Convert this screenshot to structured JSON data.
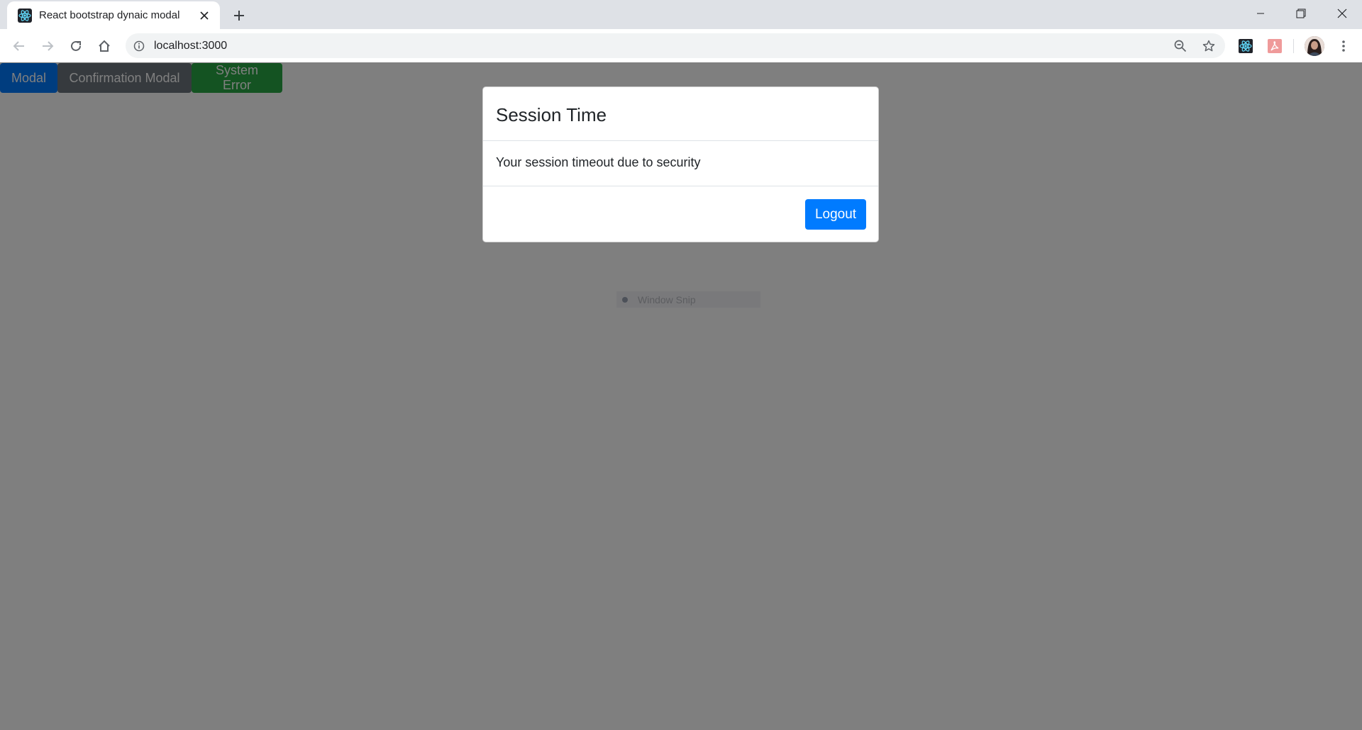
{
  "browser": {
    "tab_title": "React bootstrap dynaic modal",
    "url": "localhost:3000",
    "icons": [
      "react-favicon-icon",
      "close-icon",
      "plus-icon",
      "minimize-icon",
      "restore-icon",
      "window-close-icon",
      "back-arrow-icon",
      "forward-arrow-icon",
      "reload-icon",
      "home-icon",
      "info-icon",
      "zoom-out-icon",
      "star-icon",
      "react-devtools-icon",
      "pdf-icon",
      "more-vert-icon"
    ]
  },
  "page": {
    "buttons": {
      "modal": "Modal",
      "confirmation": "Confirmation Modal",
      "system_error": "System Error"
    },
    "snip_label": "Window Snip"
  },
  "modal": {
    "title": "Session Time",
    "body": "Your session timeout due to security",
    "logout_label": "Logout"
  },
  "colors": {
    "primary": "#007bff",
    "secondary": "#6c757d",
    "success": "#28a745",
    "backdrop": "rgba(0,0,0,0.5)",
    "chrome": "#dee1e6"
  }
}
